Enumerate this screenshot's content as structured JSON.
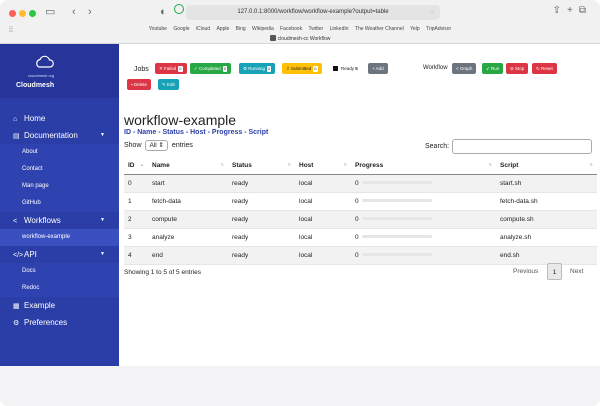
{
  "browser": {
    "url": "127.0.0.1:8000/workflow/workflow-example?output=table",
    "bookmarks": [
      "Youtube",
      "Google",
      "iCloud",
      "Apple",
      "Bing",
      "Wikipedia",
      "Facebook",
      "Twitter",
      "LinkedIn",
      "The Weather Channel",
      "Yelp",
      "TripAdvisor"
    ],
    "tab_title": "cloudmesh-cc Workflow"
  },
  "brand": {
    "tagline": "cloudmesh.org",
    "name": "Cloudmesh"
  },
  "sidebar": {
    "items": [
      {
        "label": "Home",
        "icon": "home-icon",
        "glyph": "⌂"
      },
      {
        "label": "Documentation",
        "icon": "book-icon",
        "glyph": "▤",
        "caret": "▼"
      },
      {
        "label": "About",
        "sub": true
      },
      {
        "label": "Contact",
        "sub": true
      },
      {
        "label": "Man page",
        "sub": true
      },
      {
        "label": "GitHub",
        "sub": true
      },
      {
        "label": "Workflows",
        "icon": "share-icon",
        "glyph": "<",
        "caret": "▼"
      },
      {
        "label": "workflow-example",
        "sub": true,
        "active": true
      },
      {
        "label": "API",
        "icon": "code-icon",
        "glyph": "</>",
        "caret": "▼"
      },
      {
        "label": "Docs",
        "sub": true
      },
      {
        "label": "Redoc",
        "sub": true
      },
      {
        "label": "Example",
        "icon": "table-icon",
        "glyph": "▦"
      },
      {
        "label": "Preferences",
        "icon": "gear-icon",
        "glyph": "⚙"
      }
    ]
  },
  "toolbar": {
    "jobs_label": "Jobs",
    "failed": {
      "label": "Failed",
      "count": "0",
      "color": "#dc3545"
    },
    "completed": {
      "label": "Completed",
      "count": "0",
      "color": "#28a745"
    },
    "running": {
      "label": "Running",
      "count": "0",
      "color": "#17a2b8"
    },
    "submitted": {
      "label": "Submitted",
      "count": "0",
      "color": "#ffc107"
    },
    "ready": {
      "label": "Ready",
      "count": "5"
    },
    "add": "Add",
    "delete": "Delete",
    "edit": "Edit",
    "workflow_label": "Workflow",
    "graph": "Graph",
    "run": "Run",
    "stop": "Stop",
    "reset": "Reset"
  },
  "main": {
    "title": "workflow-example",
    "subtitle": "ID - Name - Status - Host - Progress - Script",
    "show_label": "Show",
    "show_value": "All",
    "entries_label": "entries",
    "search_label": "Search:",
    "columns": [
      "ID",
      "Name",
      "Status",
      "Host",
      "Progress",
      "Script"
    ],
    "rows": [
      {
        "id": "0",
        "name": "start",
        "status": "ready",
        "host": "local",
        "progress": "0",
        "script": "start.sh"
      },
      {
        "id": "1",
        "name": "fetch-data",
        "status": "ready",
        "host": "local",
        "progress": "0",
        "script": "fetch-data.sh"
      },
      {
        "id": "2",
        "name": "compute",
        "status": "ready",
        "host": "local",
        "progress": "0",
        "script": "compute.sh"
      },
      {
        "id": "3",
        "name": "analyze",
        "status": "ready",
        "host": "local",
        "progress": "0",
        "script": "analyze.sh"
      },
      {
        "id": "4",
        "name": "end",
        "status": "ready",
        "host": "local",
        "progress": "0",
        "script": "end.sh"
      }
    ],
    "info": "Showing 1 to 5 of 5 entries",
    "previous": "Previous",
    "page": "1",
    "next": "Next"
  },
  "colors": {
    "sidebar": "#2b3ea7",
    "accent": "#2b3ea7"
  }
}
